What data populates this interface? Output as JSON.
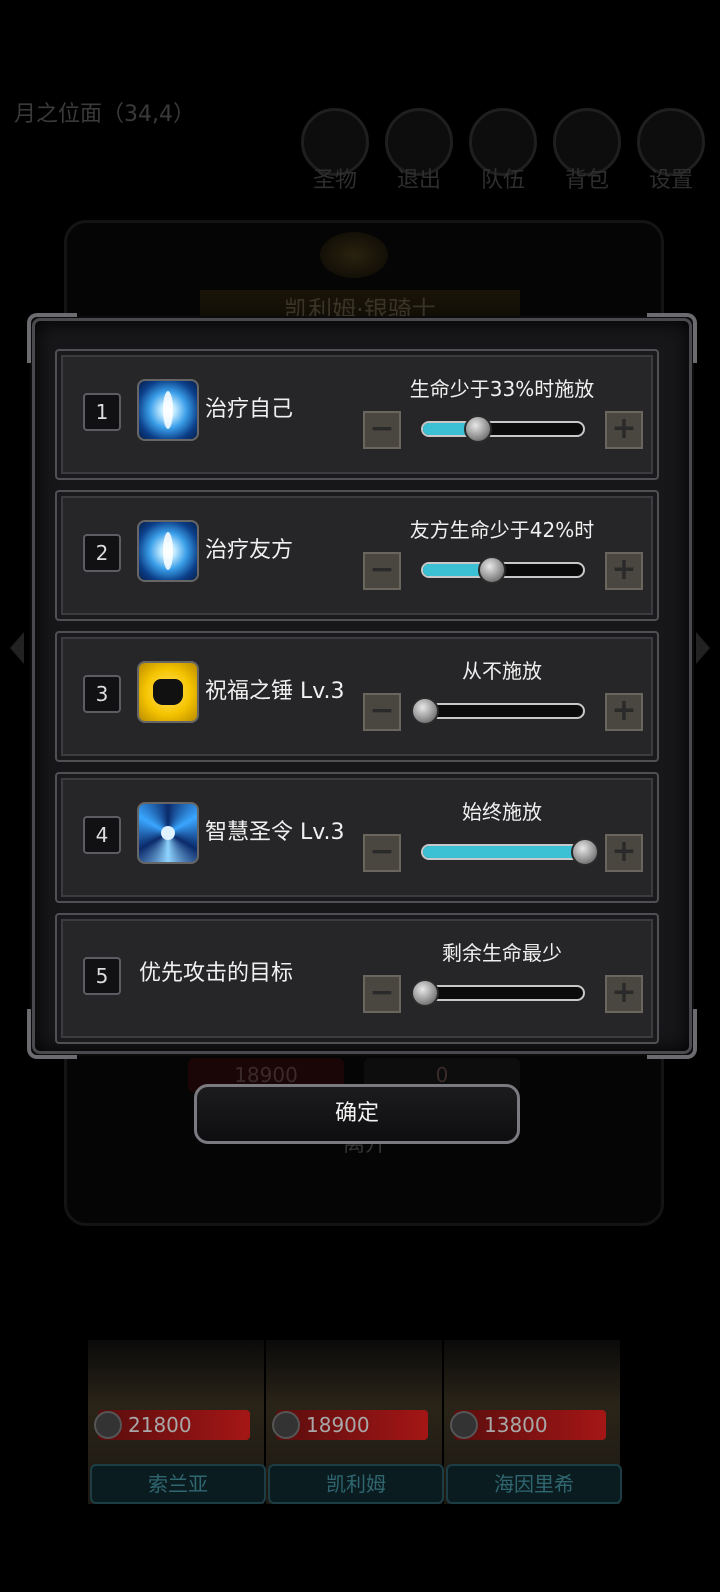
{
  "background": {
    "location": "月之位面（34,4）",
    "menu": [
      "圣物",
      "退出",
      "队伍",
      "背包",
      "设置"
    ],
    "character_name": "凯利姆·银骑士",
    "hp_value": "18900",
    "energy_value": "0",
    "leave_label": "离开",
    "party": [
      {
        "name": "索兰亚",
        "hp": "21800"
      },
      {
        "name": "凯利姆",
        "hp": "18900"
      },
      {
        "name": "海因里希",
        "hp": "13800"
      }
    ]
  },
  "dialog": {
    "rows": [
      {
        "num": "1",
        "icon": "heal-icon",
        "name": "治疗自己",
        "setting": "生命少于33%时施放",
        "level": 0.33
      },
      {
        "num": "2",
        "icon": "heal-icon",
        "name": "治疗友方",
        "setting": "友方生命少于42%时",
        "level": 0.42
      },
      {
        "num": "3",
        "icon": "fist-icon",
        "name": "祝福之锤 Lv.3",
        "setting": "从不施放",
        "level": 0.0
      },
      {
        "num": "4",
        "icon": "swirl-icon",
        "name": "智慧圣令 Lv.3",
        "setting": "始终施放",
        "level": 1.0
      },
      {
        "num": "5",
        "icon": "",
        "name": "优先攻击的目标",
        "setting": "剩余生命最少",
        "level": 0.0
      }
    ],
    "minus_label": "−",
    "plus_label": "+",
    "confirm_label": "确定"
  },
  "colors": {
    "slider_fill": "#3cc0d4",
    "panel_bg": "#262628",
    "border": "#505054"
  }
}
